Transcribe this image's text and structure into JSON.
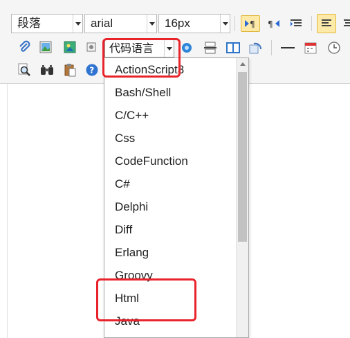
{
  "toolbar": {
    "paragraph_select": "段落",
    "font_select": "arial",
    "size_select": "16px",
    "row1_icons": [
      "ltr-icon",
      "rtl-icon",
      "indent-icon",
      "align-left-icon",
      "align-center-icon"
    ],
    "row2_icons": [
      "attachment-icon",
      "image-icon",
      "insert-image-icon",
      "video-icon",
      "code-select",
      "map-icon",
      "page-break-icon",
      "template-icon",
      "background-icon",
      "horizontal-rule-icon",
      "date-icon",
      "time-icon"
    ],
    "row3_icons": [
      "search-replace-icon",
      "binoculars-icon",
      "paste-icon",
      "help-icon"
    ]
  },
  "code_select": {
    "label": "代码语言"
  },
  "dropdown": {
    "items": [
      "ActionScript3",
      "Bash/Shell",
      "C/C++",
      "Css",
      "CodeFunction",
      "C#",
      "Delphi",
      "Diff",
      "Erlang",
      "Groovy",
      "Html",
      "Java"
    ]
  },
  "colors": {
    "highlight": "#e8232b",
    "active_button": "#fde9a8"
  }
}
